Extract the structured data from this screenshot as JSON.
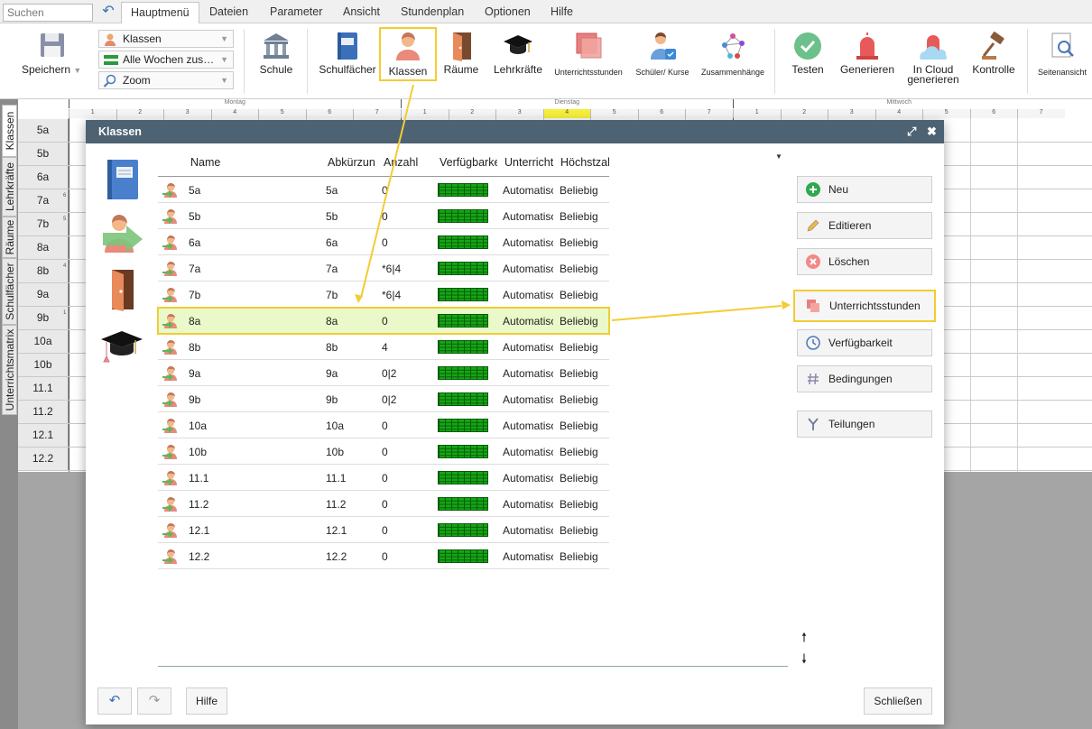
{
  "topbar": {
    "search_placeholder": "Suchen",
    "tabs": [
      "Hauptmenü",
      "Dateien",
      "Parameter",
      "Ansicht",
      "Stundenplan",
      "Optionen",
      "Hilfe"
    ],
    "active_tab": "Hauptmenü"
  },
  "ribbon": {
    "save_label": "Speichern",
    "dropdowns": {
      "view": "Klassen",
      "weeks": "Alle Wochen zus…",
      "zoom": "Zoom"
    },
    "buttons": {
      "schule": "Schule",
      "schulfaecher": "Schulfächer",
      "klassen": "Klassen",
      "raeume": "Räume",
      "lehrkraefte": "Lehrkräfte",
      "unterrichtsstunden": "Unterrichtsstunden",
      "schueler_kurse": "Schüler/ Kurse",
      "zusammenhaenge": "Zusammenhänge",
      "testen": "Testen",
      "generieren": "Generieren",
      "cloud_line1": "In Cloud",
      "cloud_line2": "generieren",
      "kontrolle": "Kontrolle",
      "seitenansicht": "Seitenansicht"
    }
  },
  "sidetabs": [
    "Klassen",
    "Lehrkräfte",
    "Räume",
    "Schulfächer",
    "Unterrichtsmatrix"
  ],
  "grid": {
    "days": [
      "Montag",
      "Dienstag",
      "Mittwoch"
    ],
    "periods": [
      "1",
      "2",
      "3",
      "4",
      "5",
      "6",
      "7"
    ],
    "highlighted": {
      "day": "Dienstag",
      "period": "4"
    },
    "rows": [
      "5a",
      "5b",
      "6a",
      "7a",
      "7b",
      "8a",
      "8b",
      "9a",
      "9b",
      "10a",
      "10b",
      "11.1",
      "11.2",
      "12.1",
      "12.2"
    ],
    "row_hints": [
      "",
      "",
      "",
      "6",
      "5",
      "",
      "4",
      "",
      "1",
      "",
      "",
      "",
      "",
      "",
      ""
    ]
  },
  "dialog": {
    "title": "Klassen",
    "columns": [
      "Name",
      "Abkürzung",
      "Anzahl",
      "Verfügbarkeit",
      "Unterricht",
      "Höchstzahl"
    ],
    "rows": [
      {
        "name": "5a",
        "abbr": "5a",
        "count": "0",
        "mode": "Automatisch",
        "max": "Beliebig"
      },
      {
        "name": "5b",
        "abbr": "5b",
        "count": "0",
        "mode": "Automatisch",
        "max": "Beliebig"
      },
      {
        "name": "6a",
        "abbr": "6a",
        "count": "0",
        "mode": "Automatisch",
        "max": "Beliebig"
      },
      {
        "name": "7a",
        "abbr": "7a",
        "count": "*6|4",
        "mode": "Automatisch",
        "max": "Beliebig"
      },
      {
        "name": "7b",
        "abbr": "7b",
        "count": "*6|4",
        "mode": "Automatisch",
        "max": "Beliebig"
      },
      {
        "name": "8a",
        "abbr": "8a",
        "count": "0",
        "mode": "Automatisch",
        "max": "Beliebig"
      },
      {
        "name": "8b",
        "abbr": "8b",
        "count": "4",
        "mode": "Automatisch",
        "max": "Beliebig"
      },
      {
        "name": "9a",
        "abbr": "9a",
        "count": "0|2",
        "mode": "Automatisch",
        "max": "Beliebig"
      },
      {
        "name": "9b",
        "abbr": "9b",
        "count": "0|2",
        "mode": "Automatisch",
        "max": "Beliebig"
      },
      {
        "name": "10a",
        "abbr": "10a",
        "count": "0",
        "mode": "Automatisch",
        "max": "Beliebig"
      },
      {
        "name": "10b",
        "abbr": "10b",
        "count": "0",
        "mode": "Automatisch",
        "max": "Beliebig"
      },
      {
        "name": "11.1",
        "abbr": "11.1",
        "count": "0",
        "mode": "Automatisch",
        "max": "Beliebig"
      },
      {
        "name": "11.2",
        "abbr": "11.2",
        "count": "0",
        "mode": "Automatisch",
        "max": "Beliebig"
      },
      {
        "name": "12.1",
        "abbr": "12.1",
        "count": "0",
        "mode": "Automatisch",
        "max": "Beliebig"
      },
      {
        "name": "12.2",
        "abbr": "12.2",
        "count": "0",
        "mode": "Automatisch",
        "max": "Beliebig"
      }
    ],
    "selected_row": "8a",
    "actions": {
      "neu": "Neu",
      "editieren": "Editieren",
      "loeschen": "Löschen",
      "unterrichtsstunden": "Unterrichtsstunden",
      "verfuegbarkeit": "Verfügbarkeit",
      "bedingungen": "Bedingungen",
      "teilungen": "Teilungen"
    },
    "footer": {
      "hilfe": "Hilfe",
      "schliessen": "Schließen"
    }
  },
  "colors": {
    "highlight": "#f2cc35",
    "selected_row": "#e9f9c9",
    "dialog_header": "#4d6272",
    "availability": "#13a813"
  }
}
